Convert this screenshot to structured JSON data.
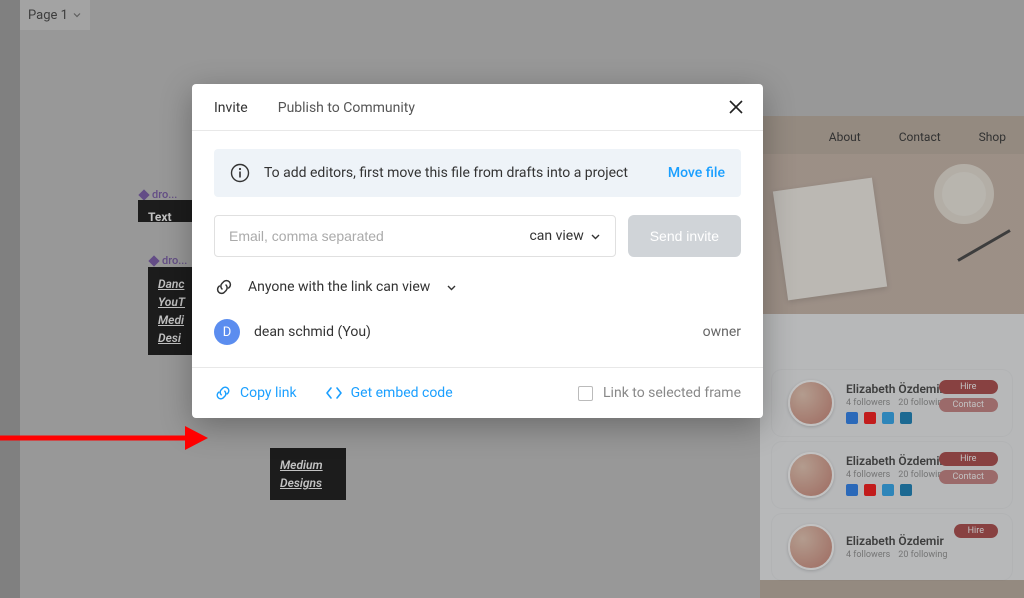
{
  "page_selector": {
    "label": "Page 1"
  },
  "canvas": {
    "frame1_label": "dro...",
    "frame1_text": "Text",
    "frame2_label": "dro...",
    "frame2_items": [
      "Danc",
      "YouT",
      "Medi",
      "Desi"
    ],
    "frame3_items": [
      "Medium",
      "Designs"
    ]
  },
  "site": {
    "nav": [
      "About",
      "Contact",
      "Shop"
    ],
    "card": {
      "name": "Elizabeth Özdemir",
      "followers": "4 followers",
      "following": "20 following",
      "hire": "Hire",
      "contact": "Contact"
    }
  },
  "modal": {
    "tabs": {
      "invite": "Invite",
      "publish": "Publish to Community"
    },
    "info_text": "To add editors, first move this file from drafts into a project",
    "move_file": "Move file",
    "email_placeholder": "Email, comma separated",
    "permission": "can view",
    "send_invite": "Send invite",
    "link_access": "Anyone with the link can view",
    "member": {
      "initial": "D",
      "name": "dean schmid (You)",
      "role": "owner"
    },
    "copy_link": "Copy link",
    "embed_code": "Get embed code",
    "link_frame": "Link to selected frame"
  }
}
